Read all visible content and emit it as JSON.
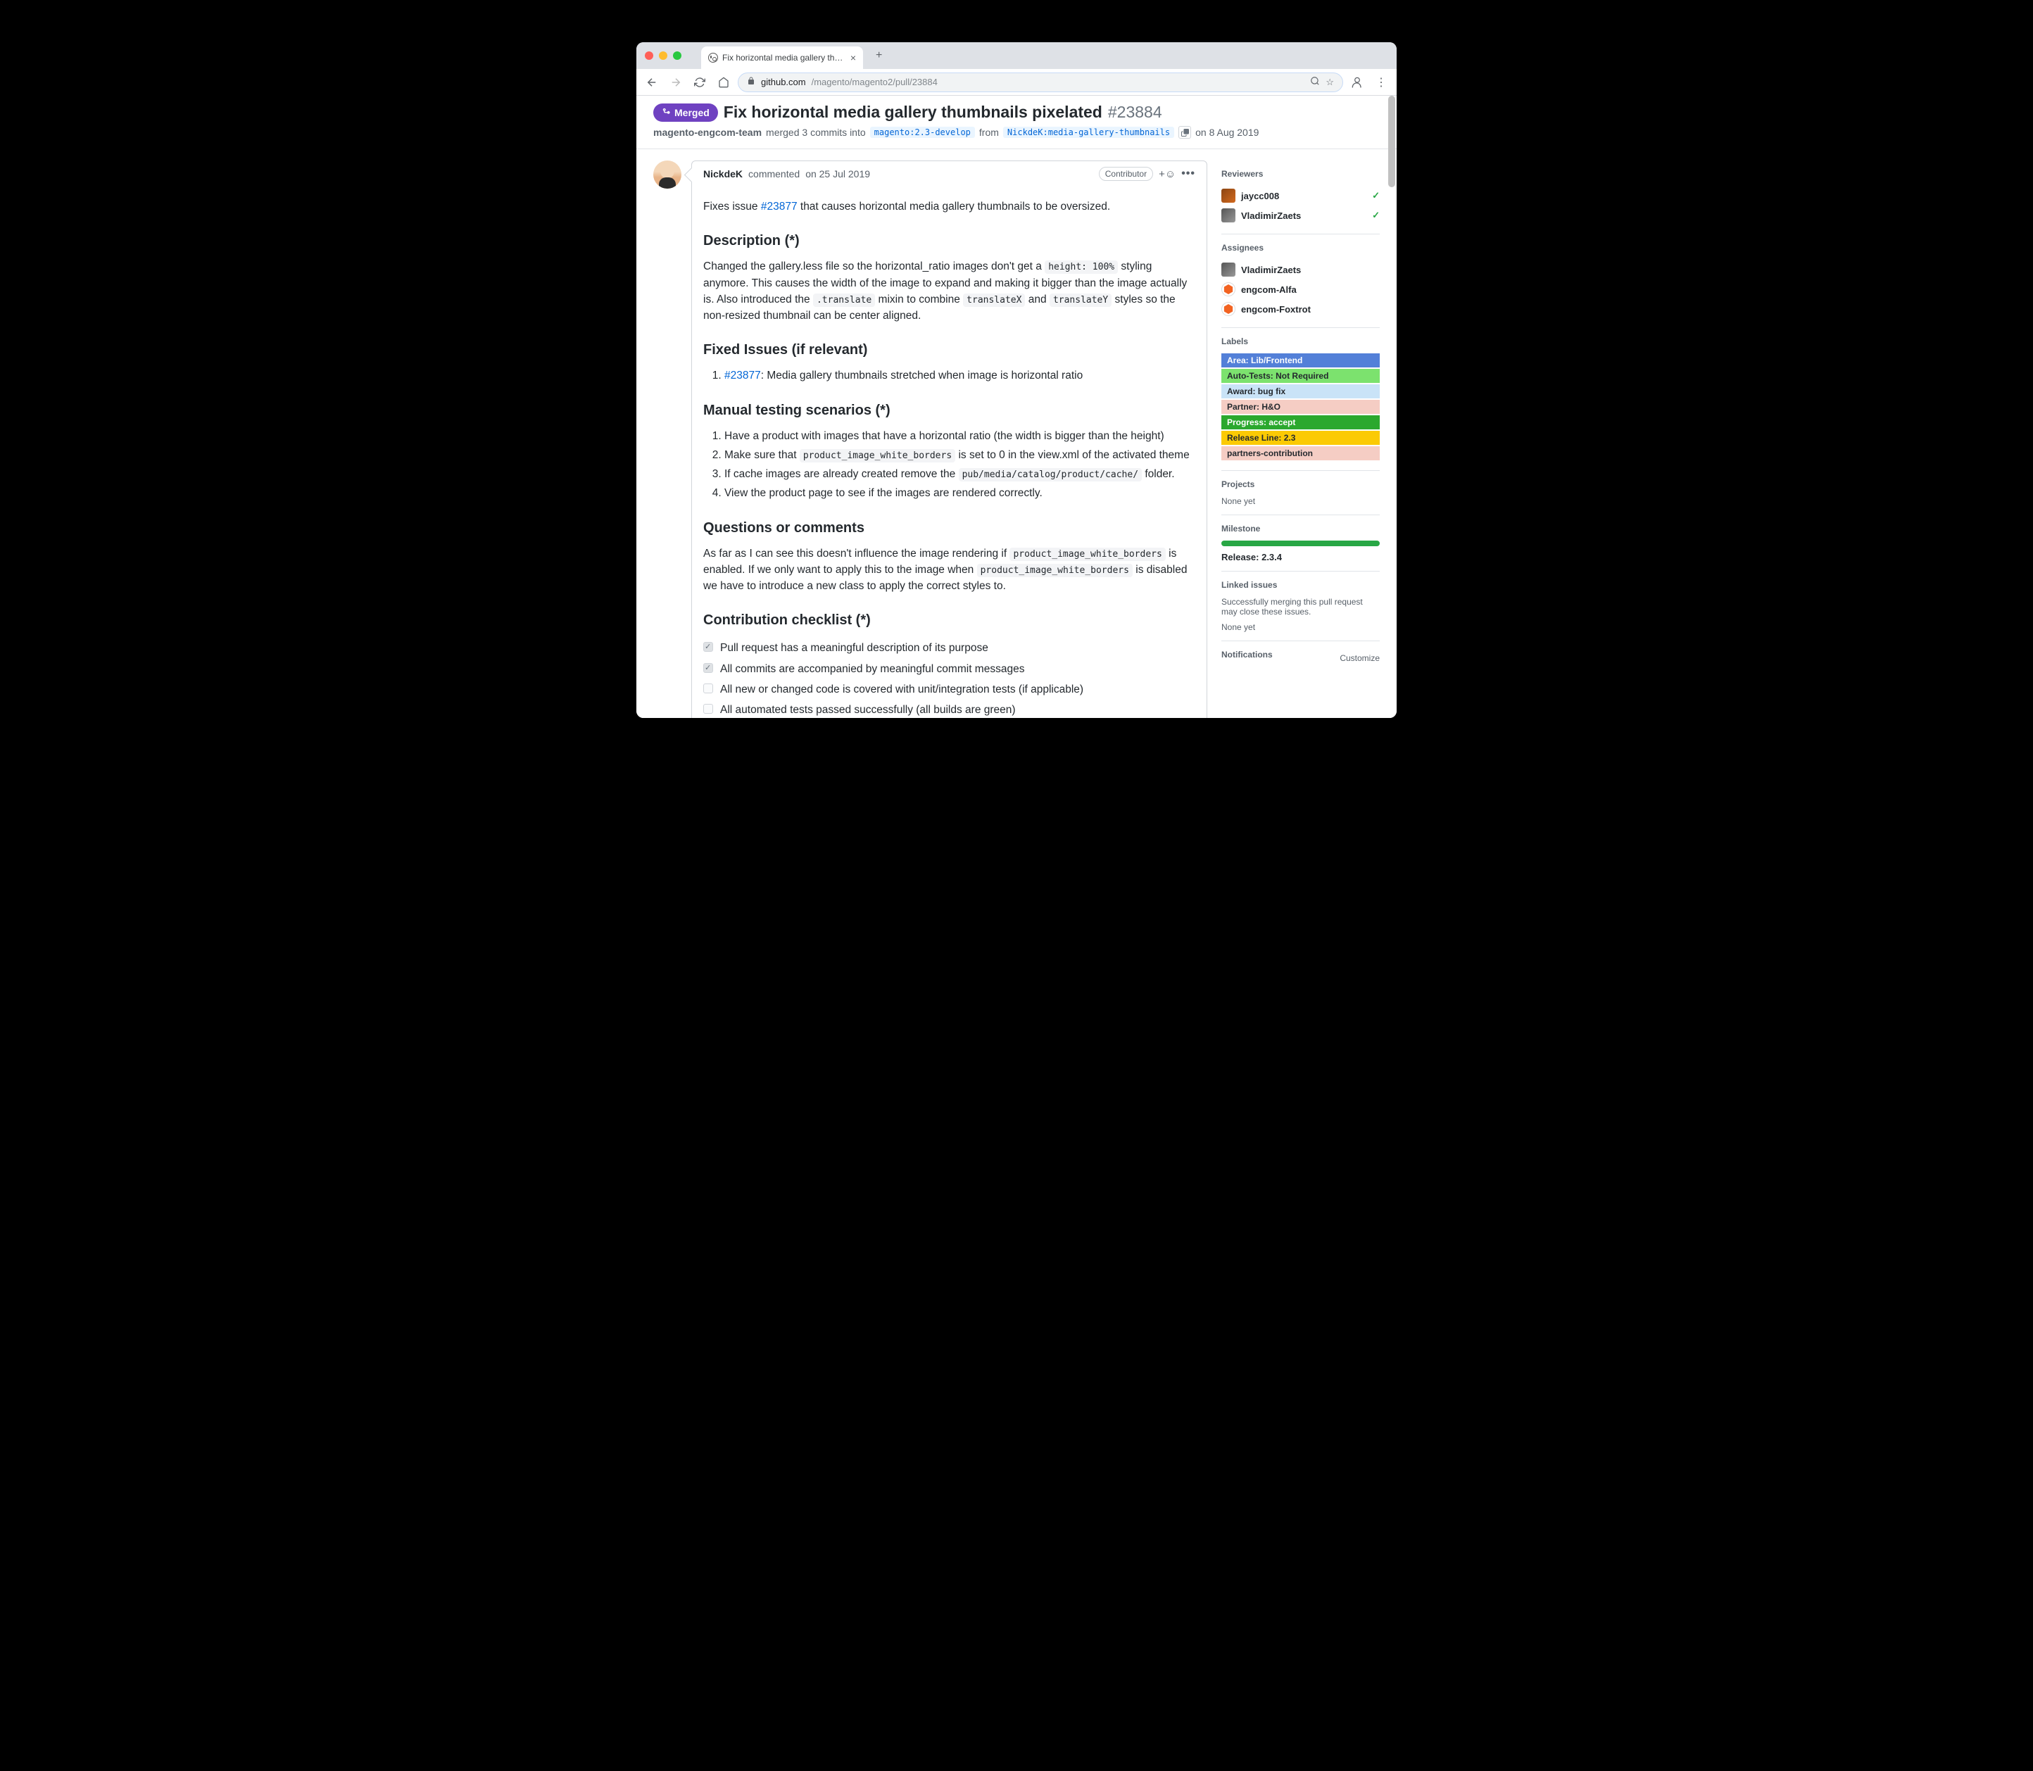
{
  "tab": {
    "title": "Fix horizontal media gallery thumbnails pixelated"
  },
  "url": {
    "host": "github.com",
    "path": "/magento/magento2/pull/23884"
  },
  "pr": {
    "state": "Merged",
    "title": "Fix horizontal media gallery thumbnails pixelated",
    "number": "#23884",
    "merger": "magento-engcom-team",
    "merge_text": "merged 3 commits into",
    "base_branch": "magento:2.3-develop",
    "from_text": "from",
    "head_branch": "NickdeK:media-gallery-thumbnails",
    "date": "on 8 Aug 2019"
  },
  "comment": {
    "author": "NickdeK",
    "action": "commented",
    "when": "on 25 Jul 2019",
    "role": "Contributor",
    "intro_before": "Fixes issue ",
    "intro_link": "#23877",
    "intro_after": " that causes horizontal media gallery thumbnails to be oversized.",
    "h_description": "Description (*)",
    "desc_p1a": "Changed the gallery.less file so the horizontal_ratio images don't get a ",
    "desc_code1": "height: 100%",
    "desc_p1b": " styling anymore. This causes the width of the image to expand and making it bigger than the image actually is. Also introduced the ",
    "desc_code2": ".translate",
    "desc_p1c": " mixin to combine ",
    "desc_code3": "translateX",
    "desc_and": " and ",
    "desc_code4": "translateY",
    "desc_p1d": " styles so the non-resized thumbnail can be center aligned.",
    "h_fixed": "Fixed Issues (if relevant)",
    "fixed_link": "#23877",
    "fixed_text": ": Media gallery thumbnails stretched when image is horizontal ratio",
    "h_manual": "Manual testing scenarios (*)",
    "steps": [
      "Have a product with images that have a horizontal ratio (the width is bigger than the height)",
      {
        "pre": "Make sure that ",
        "code": "product_image_white_borders",
        "post": " is set to 0 in the view.xml of the activated theme"
      },
      {
        "pre": "If cache images are already created remove the ",
        "code": "pub/media/catalog/product/cache/",
        "post": " folder."
      },
      "View the product page to see if the images are rendered correctly."
    ],
    "h_questions": "Questions or comments",
    "q_p1a": "As far as I can see this doesn't influence the image rendering if ",
    "q_code1": "product_image_white_borders",
    "q_p1b": " is enabled. If we only want to apply this to the image when ",
    "q_code2": "product_image_white_borders",
    "q_p1c": " is disabled we have to introduce a new class to apply the correct styles to.",
    "h_checklist": "Contribution checklist (*)",
    "checklist": [
      {
        "checked": true,
        "text": "Pull request has a meaningful description of its purpose"
      },
      {
        "checked": true,
        "text": "All commits are accompanied by meaningful commit messages"
      },
      {
        "checked": false,
        "text": "All new or changed code is covered with unit/integration tests (if applicable)"
      },
      {
        "checked": false,
        "text": "All automated tests passed successfully (all builds are green)"
      }
    ]
  },
  "sidebar": {
    "reviewers_h": "Reviewers",
    "reviewers": [
      {
        "name": "jaycc008"
      },
      {
        "name": "VladimirZaets"
      }
    ],
    "assignees_h": "Assignees",
    "assignees": [
      {
        "name": "VladimirZaets",
        "type": "user"
      },
      {
        "name": "engcom-Alfa",
        "type": "bot"
      },
      {
        "name": "engcom-Foxtrot",
        "type": "bot"
      }
    ],
    "labels_h": "Labels",
    "labels": [
      {
        "text": "Area: Lib/Frontend",
        "cls": "l1"
      },
      {
        "text": "Auto-Tests: Not Required",
        "cls": "l2"
      },
      {
        "text": "Award: bug fix",
        "cls": "l3"
      },
      {
        "text": "Partner: H&O",
        "cls": "l4"
      },
      {
        "text": "Progress: accept",
        "cls": "l5"
      },
      {
        "text": "Release Line: 2.3",
        "cls": "l6"
      },
      {
        "text": "partners-contribution",
        "cls": "l7"
      }
    ],
    "projects_h": "Projects",
    "projects_none": "None yet",
    "milestone_h": "Milestone",
    "milestone": "Release: 2.3.4",
    "linked_h": "Linked issues",
    "linked_desc": "Successfully merging this pull request may close these issues.",
    "linked_none": "None yet",
    "notifications_h": "Notifications",
    "customize": "Customize"
  }
}
